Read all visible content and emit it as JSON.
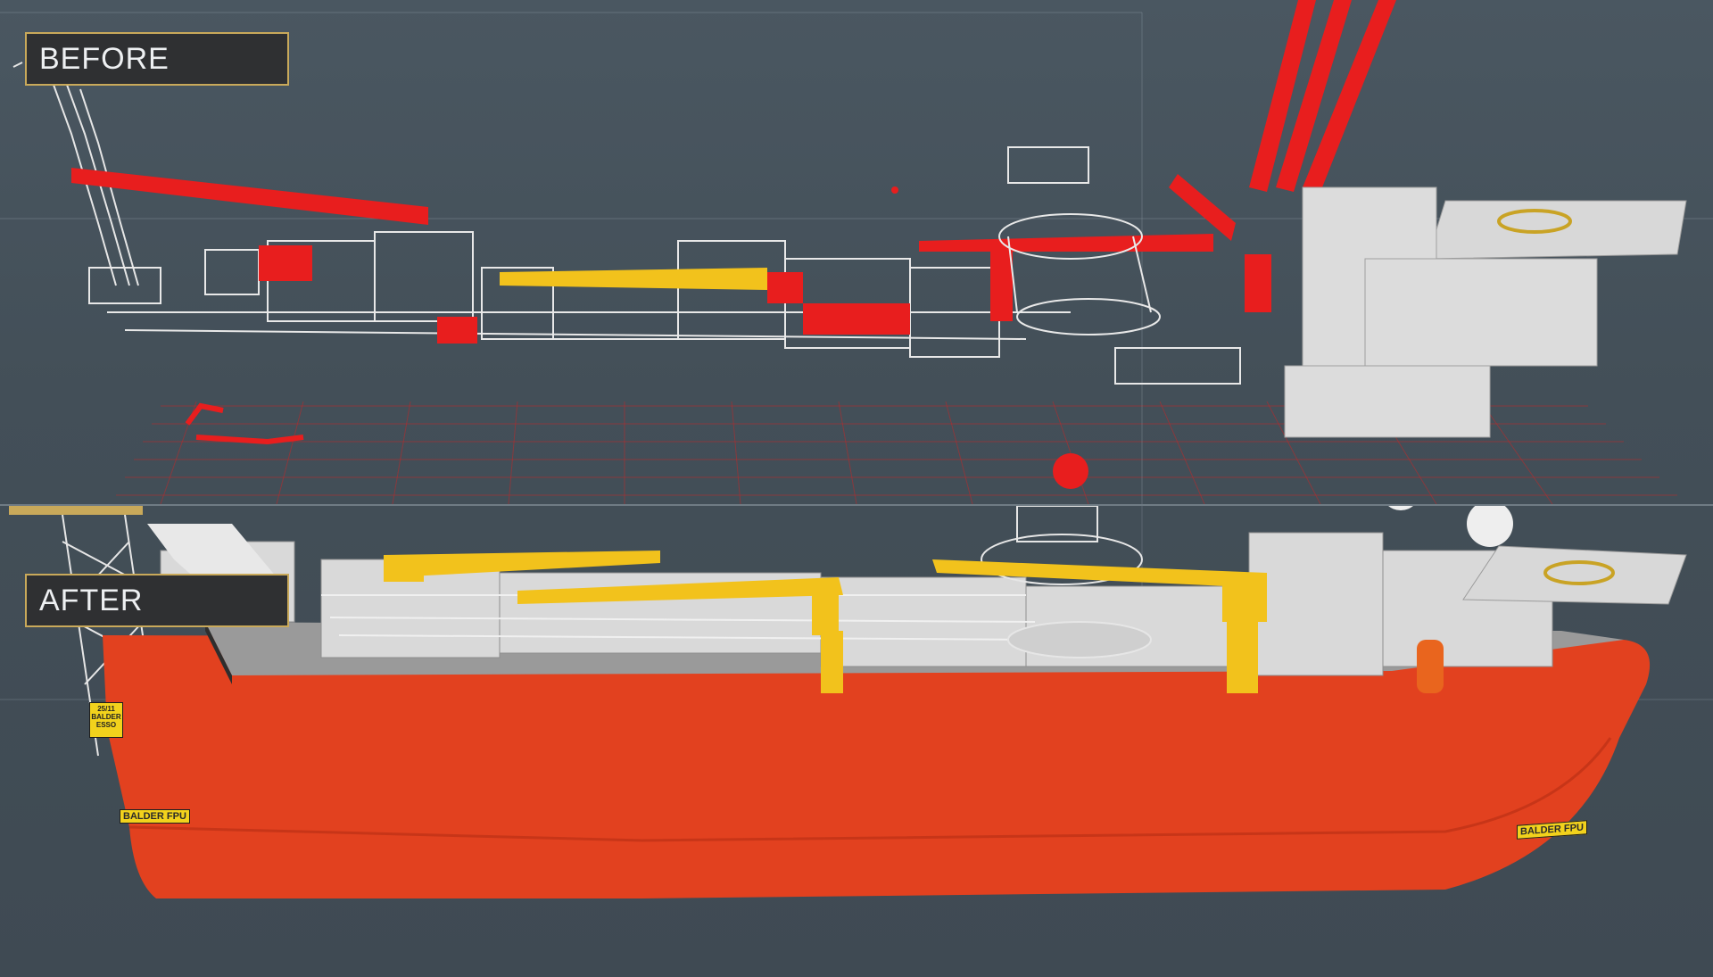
{
  "labels": {
    "before": "BEFORE",
    "after": "AFTER"
  },
  "hull": {
    "name_front": "BALDER FPU",
    "name_rear": "BALDER FPU",
    "sign_line1": "25/11",
    "sign_line2": "BALDER",
    "sign_line3": "ESSO"
  },
  "colors": {
    "background": "#45525c",
    "highlight_red": "#e81e1e",
    "crane_yellow": "#f2c21c",
    "hull_red": "#e2411f",
    "equipment_white": "#e8e8e8",
    "label_border": "#c9a95a"
  }
}
